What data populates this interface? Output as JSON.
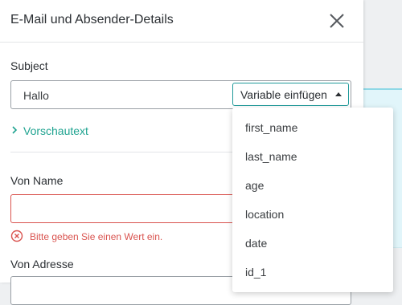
{
  "panel": {
    "title": "E-Mail und Absender-Details"
  },
  "subject": {
    "label": "Subject",
    "value": "Hallo",
    "insert_variable_label": "Variable einfügen"
  },
  "preview_text": {
    "label": "Vorschautext"
  },
  "from_name": {
    "label": "Von Name",
    "value": "",
    "error": "Bitte geben Sie einen Wert ein."
  },
  "from_address": {
    "label": "Von Adresse"
  },
  "variable_menu": {
    "items": [
      "first_name",
      "last_name",
      "age",
      "location",
      "date",
      "id_1"
    ]
  },
  "colors": {
    "accent": "#1fa390",
    "error": "#d9534f",
    "border": "#9aa0a6"
  },
  "icons": {
    "close": "close-icon",
    "caret": "caret-up-icon",
    "chevron": "chevron-right-icon",
    "error": "error-circle-icon"
  }
}
